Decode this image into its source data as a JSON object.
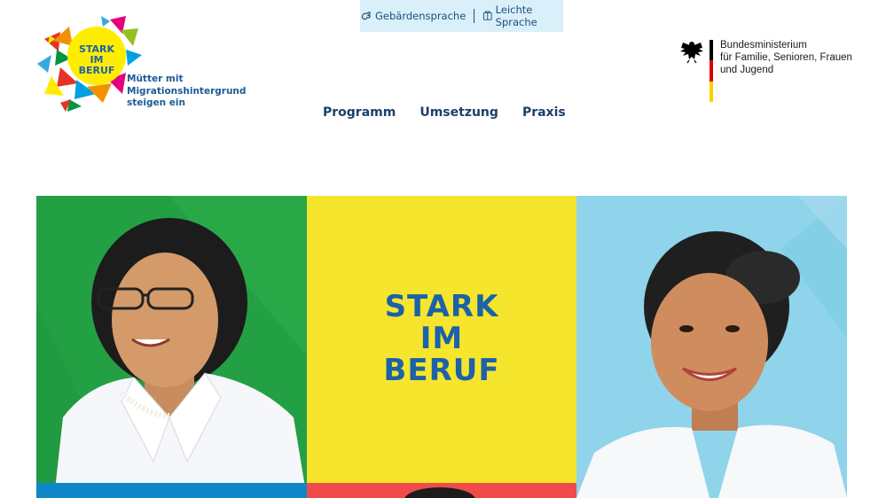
{
  "accessibility_bar": {
    "sign_language_label": "Gebärdensprache",
    "easy_language_label": "Leichte Sprache"
  },
  "logo": {
    "line1": "STARK",
    "line2": "IM",
    "line3": "BERUF",
    "tagline1": "Mütter mit",
    "tagline2": "Migrationshintergrund",
    "tagline3": "steigen ein"
  },
  "ministry": {
    "line1": "Bundesministerium",
    "line2": "für Familie, Senioren, Frauen",
    "line3": "und Jugend",
    "flag_colors": [
      "#000000",
      "#dd0000",
      "#ffce00"
    ]
  },
  "nav": {
    "items": [
      {
        "label": "Programm"
      },
      {
        "label": "Umsetzung"
      },
      {
        "label": "Praxis"
      }
    ]
  },
  "hero": {
    "title_line1": "STARK",
    "title_line2": "IM",
    "title_line3": "BERUF",
    "colors": {
      "green": "#23a043",
      "yellow": "#f5e52c",
      "light_blue": "#8fd4ea",
      "title": "#1c62a8"
    }
  }
}
